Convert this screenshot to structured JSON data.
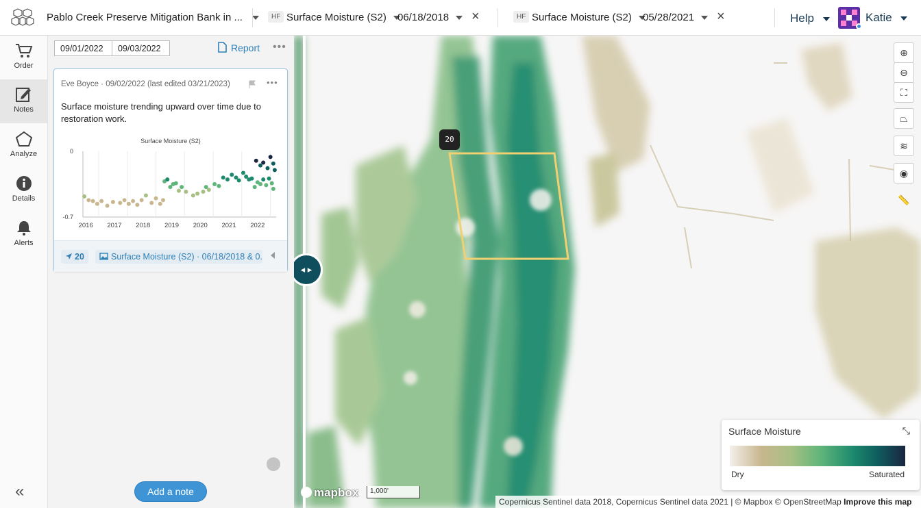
{
  "header": {
    "project_name": "Pablo Creek Preserve Mitigation Bank in ...",
    "left_layer": {
      "tag": "HF",
      "name": "Surface Moisture (S2)",
      "date": "06/18/2018"
    },
    "right_layer": {
      "tag": "HF",
      "name": "Surface Moisture (S2)",
      "date": "05/28/2021"
    },
    "help_label": "Help",
    "user_name": "Katie"
  },
  "nav": [
    {
      "label": "Order",
      "icon": "cart-icon"
    },
    {
      "label": "Notes",
      "icon": "notes-icon"
    },
    {
      "label": "Analyze",
      "icon": "pentagon-icon"
    },
    {
      "label": "Details",
      "icon": "info-icon"
    },
    {
      "label": "Alerts",
      "icon": "bell-icon"
    }
  ],
  "notes_panel": {
    "start_date": "09/01/2022",
    "end_date": "09/03/2022",
    "report_label": "Report",
    "add_note_label": "Add a note",
    "note": {
      "meta": "Eve Boyce · 09/02/2022 (last edited 03/21/2023)",
      "text": "Surface moisture trending upward over time due to restoration work.",
      "pin_chip": "20",
      "layer_chip": "Surface Moisture (S2) · 06/18/2018 & 0..."
    }
  },
  "chart_data": {
    "type": "scatter",
    "title": "Surface Moisture (S2)",
    "ylim": [
      -0.7,
      0
    ],
    "y_ticks": [
      "0",
      "-0.7"
    ],
    "x_ticks": [
      "2016",
      "2017",
      "2018",
      "2019",
      "2020",
      "2021",
      "2022"
    ],
    "xlim": [
      2015.9,
      2022.65
    ],
    "points": [
      [
        2015.95,
        -0.48
      ],
      [
        2016.1,
        -0.52
      ],
      [
        2016.25,
        -0.53
      ],
      [
        2016.4,
        -0.56
      ],
      [
        2016.55,
        -0.53
      ],
      [
        2016.75,
        -0.58
      ],
      [
        2016.95,
        -0.54
      ],
      [
        2017.2,
        -0.55
      ],
      [
        2017.35,
        -0.52
      ],
      [
        2017.5,
        -0.56
      ],
      [
        2017.65,
        -0.53
      ],
      [
        2017.8,
        -0.57
      ],
      [
        2017.95,
        -0.52
      ],
      [
        2018.1,
        -0.47
      ],
      [
        2018.3,
        -0.55
      ],
      [
        2018.45,
        -0.5
      ],
      [
        2018.6,
        -0.56
      ],
      [
        2018.7,
        -0.52
      ],
      [
        2018.75,
        -0.32
      ],
      [
        2018.85,
        -0.3
      ],
      [
        2018.95,
        -0.38
      ],
      [
        2019.05,
        -0.35
      ],
      [
        2019.15,
        -0.34
      ],
      [
        2019.25,
        -0.42
      ],
      [
        2019.35,
        -0.38
      ],
      [
        2019.5,
        -0.43
      ],
      [
        2019.75,
        -0.47
      ],
      [
        2019.9,
        -0.45
      ],
      [
        2020.1,
        -0.43
      ],
      [
        2020.2,
        -0.38
      ],
      [
        2020.3,
        -0.41
      ],
      [
        2020.5,
        -0.35
      ],
      [
        2020.65,
        -0.37
      ],
      [
        2020.8,
        -0.28
      ],
      [
        2020.95,
        -0.3
      ],
      [
        2021.1,
        -0.25
      ],
      [
        2021.25,
        -0.28
      ],
      [
        2021.35,
        -0.31
      ],
      [
        2021.5,
        -0.23
      ],
      [
        2021.6,
        -0.27
      ],
      [
        2021.7,
        -0.3
      ],
      [
        2021.8,
        -0.29
      ],
      [
        2021.9,
        -0.38
      ],
      [
        2022.0,
        -0.33
      ],
      [
        2022.1,
        -0.35
      ],
      [
        2022.2,
        -0.3
      ],
      [
        2022.3,
        -0.36
      ],
      [
        2022.4,
        -0.29
      ],
      [
        2022.5,
        -0.34
      ],
      [
        2022.55,
        -0.4
      ],
      [
        2021.95,
        -0.1
      ],
      [
        2022.1,
        -0.15
      ],
      [
        2022.2,
        -0.12
      ],
      [
        2022.35,
        -0.18
      ],
      [
        2022.45,
        -0.06
      ],
      [
        2022.55,
        -0.13
      ],
      [
        2022.6,
        -0.2
      ]
    ]
  },
  "map": {
    "pin_label": "20",
    "legend": {
      "title": "Surface Moisture",
      "low": "Dry",
      "high": "Saturated"
    },
    "mapbox_label": "mapbox",
    "scale_label": "1,000'",
    "attribution": "Copernicus Sentinel data 2018, Copernicus Sentinel data 2021 | © Mapbox © OpenStreetMap",
    "improve_label": "Improve this map"
  },
  "colors": {
    "accent": "#2e7fb5",
    "divider_handle": "#0f4e5c",
    "aoi": "#f0d071"
  }
}
